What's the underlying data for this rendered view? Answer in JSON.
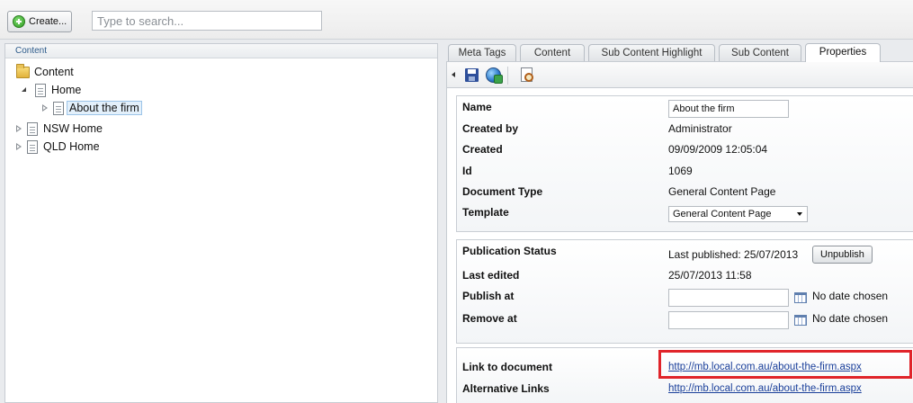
{
  "toolbar": {
    "create_label": "Create...",
    "search_placeholder": "Type to search..."
  },
  "tree": {
    "header": "Content",
    "root": "Content",
    "items": [
      {
        "label": "Home",
        "expanded": true
      },
      {
        "label": "About the firm",
        "selected": true
      },
      {
        "label": "NSW Home"
      },
      {
        "label": "QLD Home"
      }
    ]
  },
  "tabs": [
    "Meta Tags",
    "Content",
    "Sub Content Highlight",
    "Sub Content",
    "Properties"
  ],
  "active_tab": "Properties",
  "properties": {
    "name_label": "Name",
    "name_value": "About the firm",
    "created_by_label": "Created by",
    "created_by_value": "Administrator",
    "created_label": "Created",
    "created_value": "09/09/2009 12:05:04",
    "id_label": "Id",
    "id_value": "1069",
    "doctype_label": "Document Type",
    "doctype_value": "General Content Page",
    "template_label": "Template",
    "template_value": "General Content Page"
  },
  "publication": {
    "status_label": "Publication Status",
    "status_value": "Last published: 25/07/2013",
    "unpublish_label": "Unpublish",
    "last_edited_label": "Last edited",
    "last_edited_value": "25/07/2013 11:58",
    "publish_at_label": "Publish at",
    "publish_at_note": "No date chosen",
    "remove_at_label": "Remove at",
    "remove_at_note": "No date chosen"
  },
  "links": {
    "link_label": "Link to document",
    "link_value": "http://mb.local.com.au/about-the-firm.aspx",
    "alt_label": "Alternative Links",
    "alt_value": "http://mb.local.com.au/about-the-firm.aspx"
  },
  "colors": {
    "highlight": "#e0242a",
    "link": "#1a3f9a",
    "panel_header_text": "#2c5a8a"
  }
}
